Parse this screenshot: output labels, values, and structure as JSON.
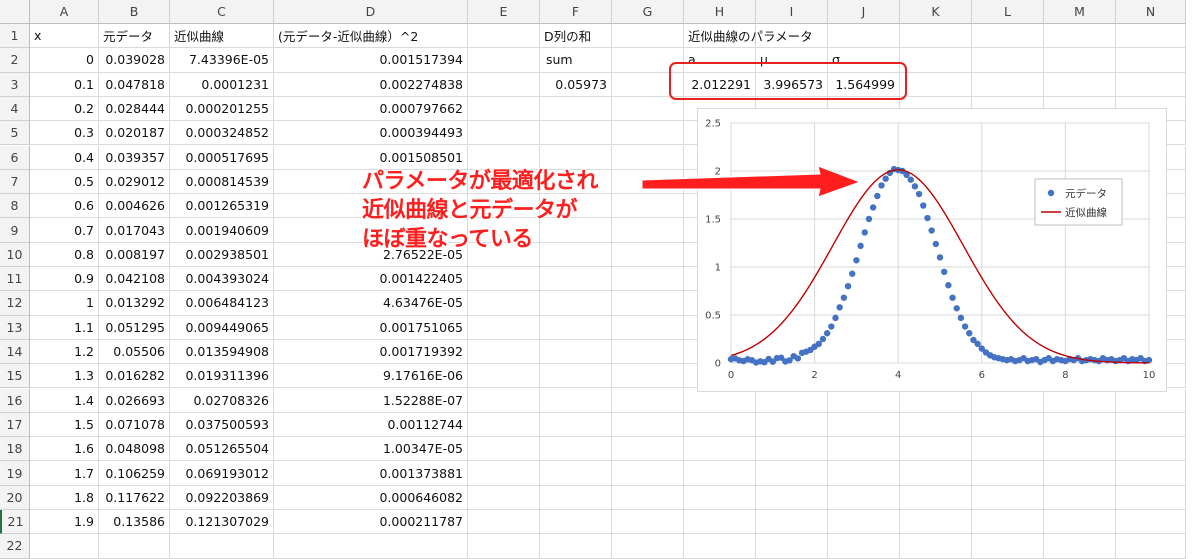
{
  "columns": [
    "A",
    "B",
    "C",
    "D",
    "E",
    "F",
    "G",
    "H",
    "I",
    "J",
    "K",
    "L",
    "M",
    "N"
  ],
  "headers_row1": {
    "A": "x",
    "B": "元データ",
    "C": "近似曲線",
    "D": "(元データ-近似曲線）^2",
    "F": "D列の和",
    "H": "近似曲線のパラメータ"
  },
  "row2_extra": {
    "F": "sum",
    "H": "a",
    "I": "μ",
    "J": "σ"
  },
  "row3_extra": {
    "F": "0.05973",
    "H": "2.012291",
    "I": "3.996573",
    "J": "1.564999"
  },
  "rows": [
    {
      "r": "2",
      "x": "0",
      "b": "0.039028",
      "c": "7.43396E-05",
      "d": "0.001517394"
    },
    {
      "r": "3",
      "x": "0.1",
      "b": "0.047818",
      "c": "0.0001231",
      "d": "0.002274838"
    },
    {
      "r": "4",
      "x": "0.2",
      "b": "0.028444",
      "c": "0.000201255",
      "d": "0.000797662"
    },
    {
      "r": "5",
      "x": "0.3",
      "b": "0.020187",
      "c": "0.000324852",
      "d": "0.000394493"
    },
    {
      "r": "6",
      "x": "0.4",
      "b": "0.039357",
      "c": "0.000517695",
      "d": "0.001508501"
    },
    {
      "r": "7",
      "x": "0.5",
      "b": "0.029012",
      "c": "0.000814539",
      "d": ""
    },
    {
      "r": "8",
      "x": "0.6",
      "b": "0.004626",
      "c": "0.001265319",
      "d": ""
    },
    {
      "r": "9",
      "x": "0.7",
      "b": "0.017043",
      "c": "0.001940609",
      "d": ""
    },
    {
      "r": "10",
      "x": "0.8",
      "b": "0.008197",
      "c": "0.002938501",
      "d": "2.76522E-05"
    },
    {
      "r": "11",
      "x": "0.9",
      "b": "0.042108",
      "c": "0.004393024",
      "d": "0.001422405"
    },
    {
      "r": "12",
      "x": "1",
      "b": "0.013292",
      "c": "0.006484123",
      "d": "4.63476E-05"
    },
    {
      "r": "13",
      "x": "1.1",
      "b": "0.051295",
      "c": "0.009449065",
      "d": "0.001751065"
    },
    {
      "r": "14",
      "x": "1.2",
      "b": "0.05506",
      "c": "0.013594908",
      "d": "0.001719392"
    },
    {
      "r": "15",
      "x": "1.3",
      "b": "0.016282",
      "c": "0.019311396",
      "d": "9.17616E-06"
    },
    {
      "r": "16",
      "x": "1.4",
      "b": "0.026693",
      "c": "0.02708326",
      "d": "1.52288E-07"
    },
    {
      "r": "17",
      "x": "1.5",
      "b": "0.071078",
      "c": "0.037500593",
      "d": "0.00112744"
    },
    {
      "r": "18",
      "x": "1.6",
      "b": "0.048098",
      "c": "0.051265504",
      "d": "1.00347E-05"
    },
    {
      "r": "19",
      "x": "1.7",
      "b": "0.106259",
      "c": "0.069193012",
      "d": "0.001373881"
    },
    {
      "r": "20",
      "x": "1.8",
      "b": "0.117622",
      "c": "0.092203869",
      "d": "0.000646082"
    },
    {
      "r": "21",
      "x": "1.9",
      "b": "0.13586",
      "c": "0.121307029",
      "d": "0.000211787"
    }
  ],
  "annotation": {
    "line1": "パラメータが最適化され",
    "line2": "近似曲線と元データが",
    "line3": "ほぼ重なっている"
  },
  "colors": {
    "annotation": "#ff1e1e",
    "points": "#4472c4",
    "curve": "#c00000"
  },
  "chart_data": {
    "type": "scatter",
    "title": "",
    "xlim": [
      0,
      10
    ],
    "ylim": [
      0,
      2.5
    ],
    "x_ticks": [
      "0",
      "2",
      "4",
      "6",
      "8",
      "10"
    ],
    "y_ticks": [
      "0",
      "0.5",
      "1",
      "1.5",
      "2",
      "2.5"
    ],
    "legend_position": "right",
    "gridlines": true,
    "series": [
      {
        "name": "元データ",
        "kind": "points",
        "x": [
          0,
          0.1,
          0.2,
          0.3,
          0.4,
          0.5,
          0.6,
          0.7,
          0.8,
          0.9,
          1,
          1.1,
          1.2,
          1.3,
          1.4,
          1.5,
          1.6,
          1.7,
          1.8,
          1.9,
          2,
          2.1,
          2.2,
          2.3,
          2.4,
          2.5,
          2.6,
          2.7,
          2.8,
          2.9,
          3,
          3.1,
          3.2,
          3.3,
          3.4,
          3.5,
          3.6,
          3.7,
          3.8,
          3.9,
          4,
          4.1,
          4.2,
          4.3,
          4.4,
          4.5,
          4.6,
          4.7,
          4.8,
          4.9,
          5,
          5.1,
          5.2,
          5.3,
          5.4,
          5.5,
          5.6,
          5.7,
          5.8,
          5.9,
          6,
          6.1,
          6.2,
          6.3,
          6.4,
          6.5,
          6.6,
          6.7,
          6.8,
          6.9,
          7,
          7.1,
          7.2,
          7.3,
          7.4,
          7.5,
          7.6,
          7.7,
          7.8,
          7.9,
          8,
          8.1,
          8.2,
          8.3,
          8.4,
          8.5,
          8.6,
          8.7,
          8.8,
          8.9,
          9,
          9.1,
          9.2,
          9.3,
          9.4,
          9.5,
          9.6,
          9.7,
          9.8,
          9.9,
          10
        ],
        "y": [
          0.039,
          0.048,
          0.028,
          0.02,
          0.039,
          0.029,
          0.005,
          0.017,
          0.008,
          0.042,
          0.013,
          0.051,
          0.055,
          0.016,
          0.027,
          0.071,
          0.048,
          0.106,
          0.118,
          0.136,
          0.17,
          0.2,
          0.25,
          0.31,
          0.38,
          0.47,
          0.58,
          0.68,
          0.8,
          0.93,
          1.07,
          1.22,
          1.36,
          1.5,
          1.62,
          1.74,
          1.85,
          1.92,
          1.98,
          2.02,
          2.01,
          2.0,
          1.96,
          1.91,
          1.84,
          1.76,
          1.64,
          1.51,
          1.38,
          1.24,
          1.1,
          0.95,
          0.81,
          0.68,
          0.57,
          0.47,
          0.38,
          0.31,
          0.24,
          0.2,
          0.15,
          0.11,
          0.08,
          0.06,
          0.05,
          0.04,
          0.03,
          0.04,
          0.02,
          0.03,
          0.05,
          0.02,
          0.03,
          0.04,
          0.01,
          0.03,
          0.05,
          0.02,
          0.04,
          0.03,
          0.02,
          0.04,
          0.03,
          0.05,
          0.02,
          0.03,
          0.04,
          0.03,
          0.02,
          0.05,
          0.03,
          0.04,
          0.02,
          0.03,
          0.05,
          0.02,
          0.04,
          0.03,
          0.05,
          0.02,
          0.03
        ]
      },
      {
        "name": "近似曲線",
        "kind": "line",
        "a": 2.012291,
        "mu": 3.996573,
        "sigma": 1.564999
      }
    ]
  }
}
